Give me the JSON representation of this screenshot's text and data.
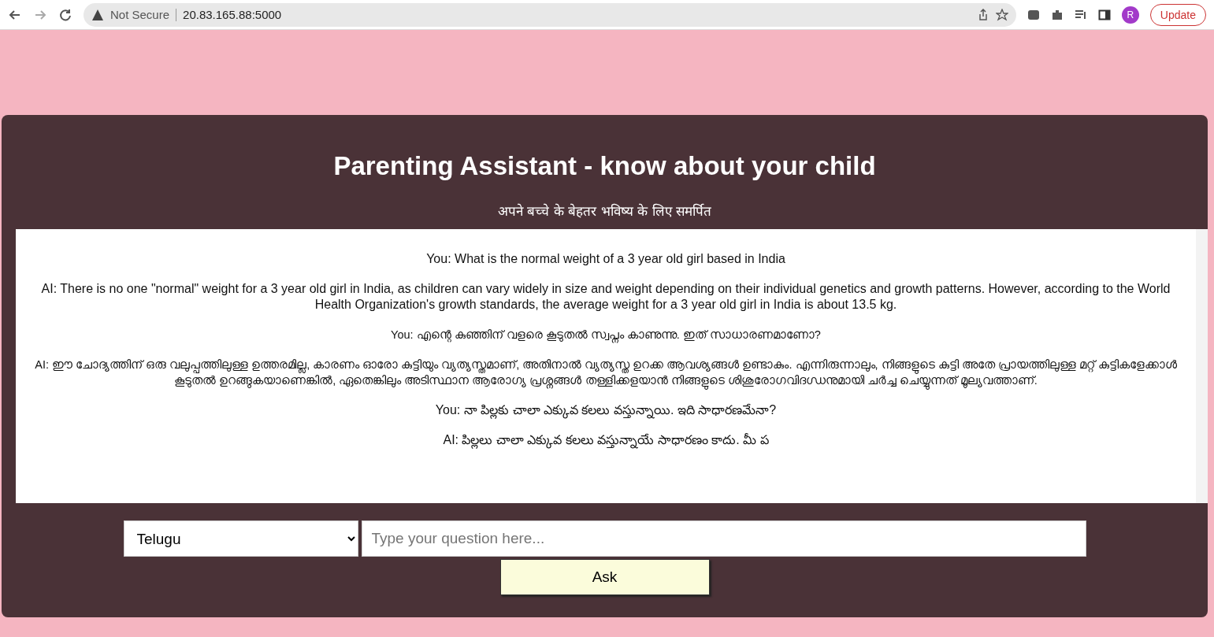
{
  "browser": {
    "security_label": "Not Secure",
    "url": "20.83.165.88:5000",
    "profile_initial": "R",
    "update_button": "Update"
  },
  "header": {
    "title": "Parenting Assistant - know about your child",
    "subtitle": "अपने बच्चे के बेहतर भविष्य के लिए समर्पित"
  },
  "messages": [
    {
      "text": "You: What is the normal weight of a 3 year old girl based in India"
    },
    {
      "text": "AI: There is no one \"normal\" weight for a 3 year old girl in India, as children can vary widely in size and weight depending on their individual genetics and growth patterns. However, according to the World Health Organization's growth standards, the average weight for a 3 year old girl in India is about 13.5 kg."
    },
    {
      "text": "You: എന്റെ കുഞ്ഞിന് വളരെ കൂടുതൽ സ്വപ്നം കാണുന്നു. ഇത് സാധാരണമാണോ?"
    },
    {
      "text": "AI: ഈ ചോദ്യത്തിന് ഒരു വലുപ്പത്തിലുള്ള ഉത്തരമില്ല, കാരണം ഓരോ കുട്ടിയും വ്യത്യസ്തമാണ്, അതിനാൽ വ്യത്യസ്ത ഉറക്ക ആവശ്യങ്ങൾ ഉണ്ടാകും. എന്നിരുന്നാലും, നിങ്ങളുടെ കുട്ടി അതേ പ്രായത്തിലുള്ള മറ്റ് കുട്ടികളേക്കാൾ കൂടുതൽ ഉറങ്ങുകയാണെങ്കിൽ, ഏതെങ്കിലും അടിസ്ഥാന ആരോഗ്യ പ്രശ്നങ്ങൾ തള്ളിക്കളയാൻ നിങ്ങളുടെ ശിശുരോഗവിദഗ്ധനുമായി ചർച്ച ചെയ്യുന്നത് മൂല്യവത്താണ്."
    },
    {
      "text": "You: నా పిల్లకు చాలా ఎక్కువ కలలు వస్తున్నాయి. ఇది సాధారణమేనా?"
    },
    {
      "text": "AI: పిల్లలు చాలా ఎక్కువ కలలు వస్తున్నాయే సాధారణం కాదు. మీ ప"
    }
  ],
  "form": {
    "language": "Telugu",
    "question_placeholder": "Type your question here...",
    "ask_button": "Ask"
  }
}
